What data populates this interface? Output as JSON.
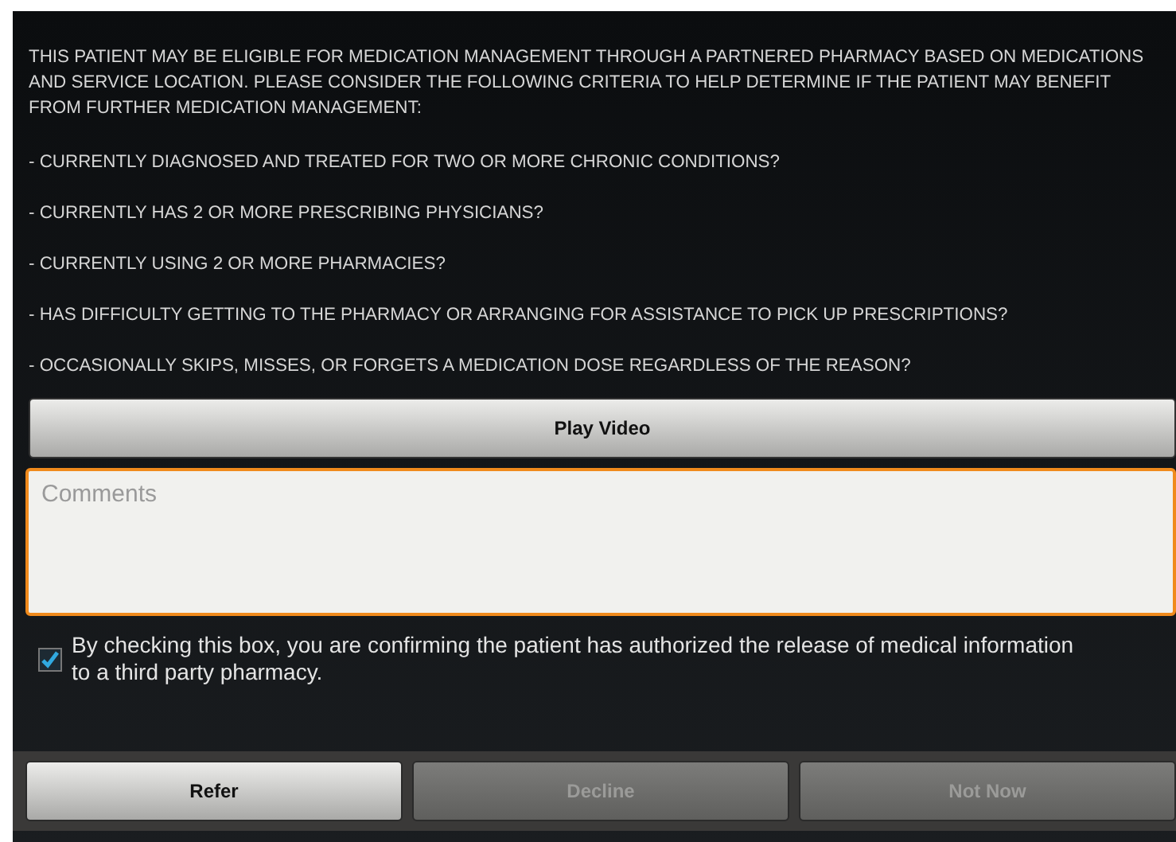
{
  "intro": "THIS PATIENT MAY BE ELIGIBLE FOR MEDICATION MANAGEMENT THROUGH A PARTNERED PHARMACY BASED ON MEDICATIONS AND SERVICE LOCATION. PLEASE CONSIDER THE FOLLOWING CRITERIA TO HELP DETERMINE IF THE PATIENT MAY BENEFIT FROM FURTHER MEDICATION MANAGEMENT:",
  "criteria": [
    "- CURRENTLY DIAGNOSED AND TREATED FOR TWO OR MORE CHRONIC CONDITIONS?",
    "- CURRENTLY HAS 2 OR MORE PRESCRIBING PHYSICIANS?",
    "- CURRENTLY USING 2 OR MORE PHARMACIES?",
    "- HAS DIFFICULTY GETTING TO THE PHARMACY OR ARRANGING FOR ASSISTANCE TO PICK UP PRESCRIPTIONS?",
    "- OCCASIONALLY SKIPS, MISSES, OR FORGETS A MEDICATION DOSE REGARDLESS OF THE REASON?"
  ],
  "play_button": "Play Video",
  "comments": {
    "placeholder": "Comments"
  },
  "consent": {
    "checked": true,
    "label": "By checking this box, you are confirming the patient has authorized the release of medical information to a third party pharmacy."
  },
  "actions": [
    {
      "label": "Refer",
      "disabled": false
    },
    {
      "label": "Decline",
      "disabled": true
    },
    {
      "label": "Not Now",
      "disabled": true
    }
  ]
}
